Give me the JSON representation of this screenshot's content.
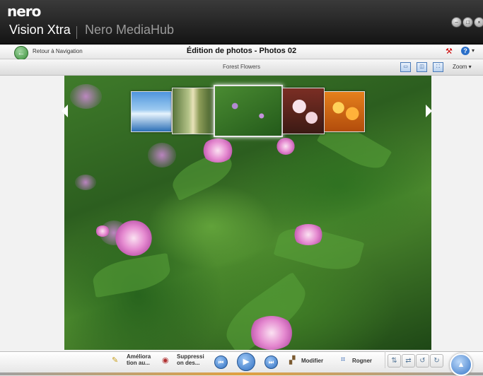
{
  "app": {
    "logo": "nero",
    "product": "Vision Xtra",
    "hub": "Nero MediaHub",
    "window_controls": [
      "minimize-icon",
      "maximize-icon",
      "close-icon"
    ]
  },
  "nav": {
    "back_label": "Retour à Navigation",
    "title": "Édition de photos - Photos 02",
    "help_symbol": "?",
    "caret": "▾"
  },
  "subbar": {
    "album_title": "Forest Flowers",
    "zoom_label": "Zoom ▾"
  },
  "viewer": {
    "thumbnails": [
      {
        "name": "iceberg",
        "colors": [
          "#6fb2ea",
          "#d9eefc"
        ]
      },
      {
        "name": "forest-path",
        "colors": [
          "#7c8f4a",
          "#d6d9a3"
        ]
      },
      {
        "name": "forest-flowers",
        "colors": [
          "#2f6b22",
          "#b07ed4"
        ],
        "selected": true
      },
      {
        "name": "white-flowers",
        "colors": [
          "#8a3a2b",
          "#f6e0e6"
        ]
      },
      {
        "name": "orange-flowers",
        "colors": [
          "#e37b15",
          "#f9c24a"
        ]
      }
    ]
  },
  "toolbar": {
    "enhance_label_1": "Améliora",
    "enhance_label_2": "tion au...",
    "remove_label_1": "Suppressi",
    "remove_label_2": "on des...",
    "prev_symbol": "⏮",
    "play_symbol": "▶",
    "next_symbol": "⏭",
    "edit_label": "Modifier",
    "crop_label": "Rogner"
  },
  "colors": {
    "accent": "#2f6fc1",
    "titlebar": "#1e1e1e",
    "back_button": "#3b8f3b"
  }
}
